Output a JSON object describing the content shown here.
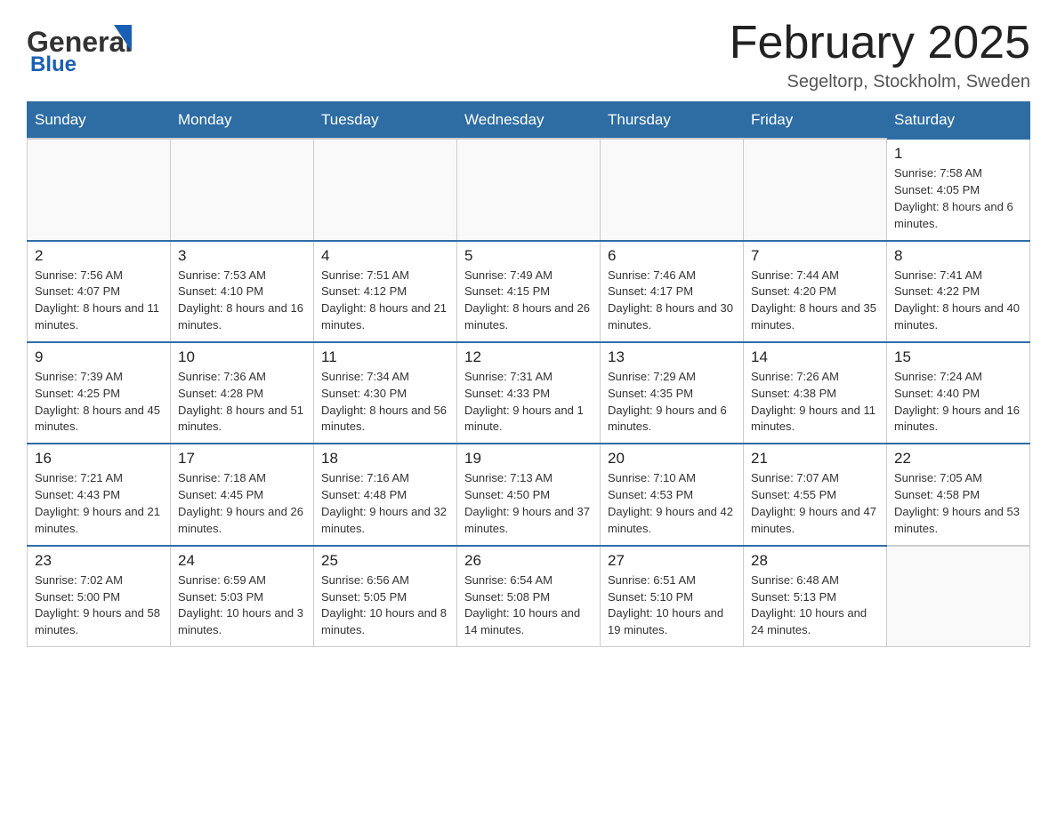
{
  "logo": {
    "general": "General",
    "blue": "Blue"
  },
  "header": {
    "title": "February 2025",
    "location": "Segeltorp, Stockholm, Sweden"
  },
  "weekdays": [
    "Sunday",
    "Monday",
    "Tuesday",
    "Wednesday",
    "Thursday",
    "Friday",
    "Saturday"
  ],
  "weeks": [
    [
      {
        "day": "",
        "info": ""
      },
      {
        "day": "",
        "info": ""
      },
      {
        "day": "",
        "info": ""
      },
      {
        "day": "",
        "info": ""
      },
      {
        "day": "",
        "info": ""
      },
      {
        "day": "",
        "info": ""
      },
      {
        "day": "1",
        "info": "Sunrise: 7:58 AM\nSunset: 4:05 PM\nDaylight: 8 hours and 6 minutes."
      }
    ],
    [
      {
        "day": "2",
        "info": "Sunrise: 7:56 AM\nSunset: 4:07 PM\nDaylight: 8 hours and 11 minutes."
      },
      {
        "day": "3",
        "info": "Sunrise: 7:53 AM\nSunset: 4:10 PM\nDaylight: 8 hours and 16 minutes."
      },
      {
        "day": "4",
        "info": "Sunrise: 7:51 AM\nSunset: 4:12 PM\nDaylight: 8 hours and 21 minutes."
      },
      {
        "day": "5",
        "info": "Sunrise: 7:49 AM\nSunset: 4:15 PM\nDaylight: 8 hours and 26 minutes."
      },
      {
        "day": "6",
        "info": "Sunrise: 7:46 AM\nSunset: 4:17 PM\nDaylight: 8 hours and 30 minutes."
      },
      {
        "day": "7",
        "info": "Sunrise: 7:44 AM\nSunset: 4:20 PM\nDaylight: 8 hours and 35 minutes."
      },
      {
        "day": "8",
        "info": "Sunrise: 7:41 AM\nSunset: 4:22 PM\nDaylight: 8 hours and 40 minutes."
      }
    ],
    [
      {
        "day": "9",
        "info": "Sunrise: 7:39 AM\nSunset: 4:25 PM\nDaylight: 8 hours and 45 minutes."
      },
      {
        "day": "10",
        "info": "Sunrise: 7:36 AM\nSunset: 4:28 PM\nDaylight: 8 hours and 51 minutes."
      },
      {
        "day": "11",
        "info": "Sunrise: 7:34 AM\nSunset: 4:30 PM\nDaylight: 8 hours and 56 minutes."
      },
      {
        "day": "12",
        "info": "Sunrise: 7:31 AM\nSunset: 4:33 PM\nDaylight: 9 hours and 1 minute."
      },
      {
        "day": "13",
        "info": "Sunrise: 7:29 AM\nSunset: 4:35 PM\nDaylight: 9 hours and 6 minutes."
      },
      {
        "day": "14",
        "info": "Sunrise: 7:26 AM\nSunset: 4:38 PM\nDaylight: 9 hours and 11 minutes."
      },
      {
        "day": "15",
        "info": "Sunrise: 7:24 AM\nSunset: 4:40 PM\nDaylight: 9 hours and 16 minutes."
      }
    ],
    [
      {
        "day": "16",
        "info": "Sunrise: 7:21 AM\nSunset: 4:43 PM\nDaylight: 9 hours and 21 minutes."
      },
      {
        "day": "17",
        "info": "Sunrise: 7:18 AM\nSunset: 4:45 PM\nDaylight: 9 hours and 26 minutes."
      },
      {
        "day": "18",
        "info": "Sunrise: 7:16 AM\nSunset: 4:48 PM\nDaylight: 9 hours and 32 minutes."
      },
      {
        "day": "19",
        "info": "Sunrise: 7:13 AM\nSunset: 4:50 PM\nDaylight: 9 hours and 37 minutes."
      },
      {
        "day": "20",
        "info": "Sunrise: 7:10 AM\nSunset: 4:53 PM\nDaylight: 9 hours and 42 minutes."
      },
      {
        "day": "21",
        "info": "Sunrise: 7:07 AM\nSunset: 4:55 PM\nDaylight: 9 hours and 47 minutes."
      },
      {
        "day": "22",
        "info": "Sunrise: 7:05 AM\nSunset: 4:58 PM\nDaylight: 9 hours and 53 minutes."
      }
    ],
    [
      {
        "day": "23",
        "info": "Sunrise: 7:02 AM\nSunset: 5:00 PM\nDaylight: 9 hours and 58 minutes."
      },
      {
        "day": "24",
        "info": "Sunrise: 6:59 AM\nSunset: 5:03 PM\nDaylight: 10 hours and 3 minutes."
      },
      {
        "day": "25",
        "info": "Sunrise: 6:56 AM\nSunset: 5:05 PM\nDaylight: 10 hours and 8 minutes."
      },
      {
        "day": "26",
        "info": "Sunrise: 6:54 AM\nSunset: 5:08 PM\nDaylight: 10 hours and 14 minutes."
      },
      {
        "day": "27",
        "info": "Sunrise: 6:51 AM\nSunset: 5:10 PM\nDaylight: 10 hours and 19 minutes."
      },
      {
        "day": "28",
        "info": "Sunrise: 6:48 AM\nSunset: 5:13 PM\nDaylight: 10 hours and 24 minutes."
      },
      {
        "day": "",
        "info": ""
      }
    ]
  ]
}
